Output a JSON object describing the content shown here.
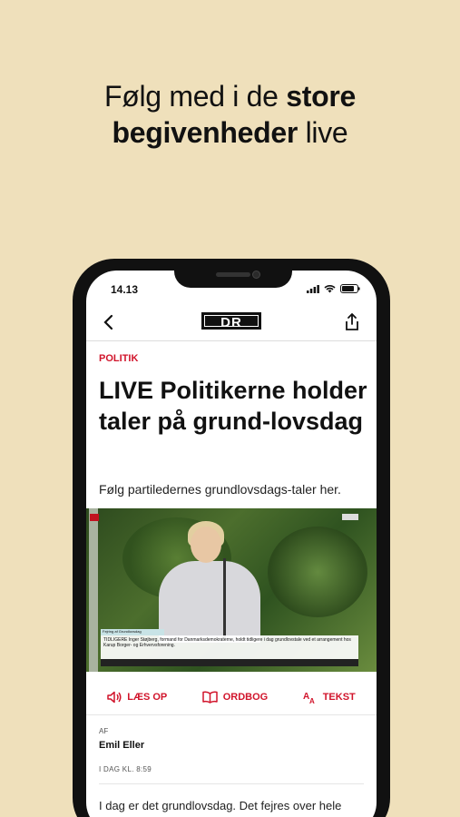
{
  "promo": {
    "line1_pre": "Følg med i de ",
    "line1_bold": "store",
    "line2_bold": "begivenheder",
    "line2_post": " live"
  },
  "status_bar": {
    "time": "14.13"
  },
  "navbar": {
    "logo": "DR"
  },
  "article": {
    "category": "POLITIK",
    "title": "LIVE Politikerne holder taler på grund-lovsdag",
    "subtitle": "Følg partiledernes grundlovsdags-taler her.",
    "video_caption": "TIDLIGERE Inger Støjberg, formand for Danmarksdemokraterne, holdt tidligere i dag grundlovstale ved et arrangement hos Karup Borger- og Erhvervsforening.",
    "video_tag": "Fejring af Grundlovsdag",
    "author_label": "AF",
    "author_name": "Emil Eller",
    "date": "I DAG KL. 8:59",
    "body": "I dag er det grundlovsdag. Det fejres over hele"
  },
  "actions": [
    {
      "label": "LÆS OP",
      "icon": "speaker-icon"
    },
    {
      "label": "ORDBOG",
      "icon": "book-icon"
    },
    {
      "label": "TEKST",
      "icon": "text-size-icon"
    }
  ],
  "colors": {
    "background": "#efe0bb",
    "accent": "#d1142b"
  }
}
